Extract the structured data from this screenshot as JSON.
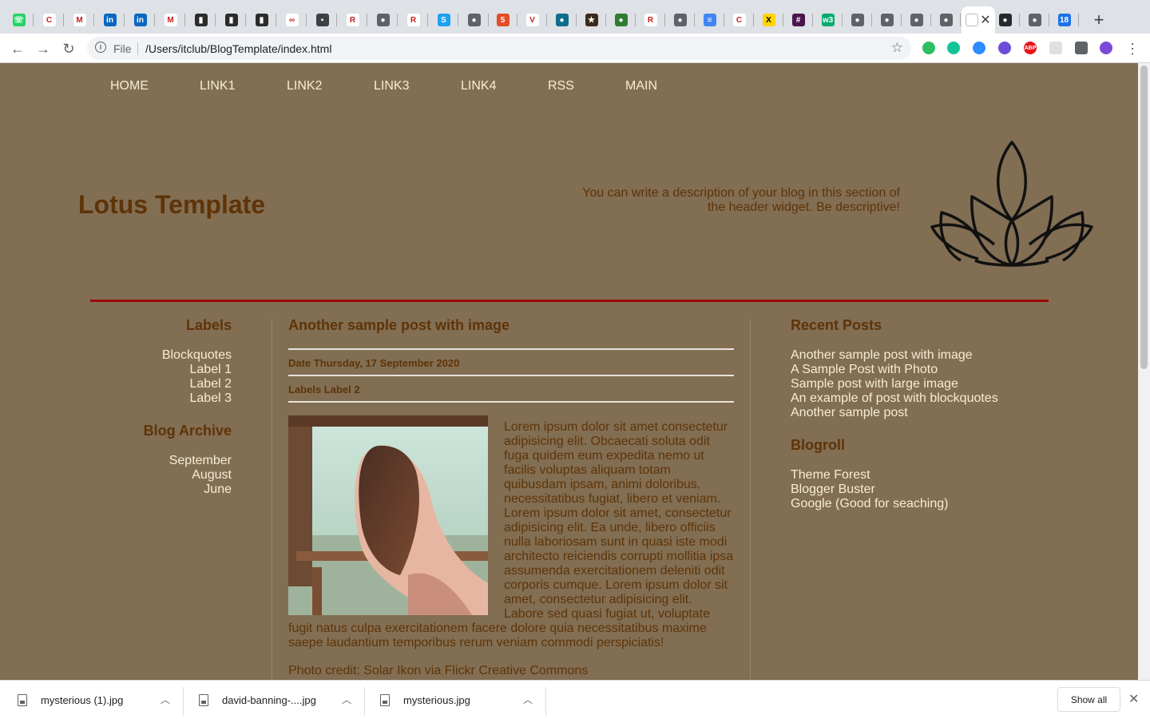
{
  "browser": {
    "tabs": [
      {
        "icon": "whatsapp-icon",
        "color": "#25d366",
        "glyph": "☏"
      },
      {
        "icon": "canon-icon",
        "color": "#ffffff",
        "glyph": "C"
      },
      {
        "icon": "gmail-icon",
        "color": "#ffffff",
        "glyph": "M"
      },
      {
        "icon": "linkedin-icon",
        "color": "#0a66c2",
        "glyph": "in"
      },
      {
        "icon": "linkedin-icon",
        "color": "#0a66c2",
        "glyph": "in"
      },
      {
        "icon": "gmail-icon",
        "color": "#ffffff",
        "glyph": "M"
      },
      {
        "icon": "book-icon",
        "color": "#2b2b2b",
        "glyph": "▮"
      },
      {
        "icon": "book-icon",
        "color": "#2b2b2b",
        "glyph": "▮"
      },
      {
        "icon": "book-icon",
        "color": "#2b2b2b",
        "glyph": "▮"
      },
      {
        "icon": "link-icon",
        "color": "#ffffff",
        "glyph": "∞"
      },
      {
        "icon": "contact-icon",
        "color": "#3c4043",
        "glyph": "▪"
      },
      {
        "icon": "r-icon",
        "color": "#ffffff",
        "glyph": "R"
      },
      {
        "icon": "globe-icon",
        "color": "#5f6368",
        "glyph": "●"
      },
      {
        "icon": "r-icon",
        "color": "#ffffff",
        "glyph": "R"
      },
      {
        "icon": "s-icon",
        "color": "#1da1f2",
        "glyph": "S"
      },
      {
        "icon": "globe-icon",
        "color": "#5f6368",
        "glyph": "●"
      },
      {
        "icon": "html5-icon",
        "color": "#e44d26",
        "glyph": "5"
      },
      {
        "icon": "v-icon",
        "color": "#ffffff",
        "glyph": "V"
      },
      {
        "icon": "drop-icon",
        "color": "#0d6e8c",
        "glyph": "●"
      },
      {
        "icon": "star-icon",
        "color": "#3b2a1a",
        "glyph": "★"
      },
      {
        "icon": "turtle-icon",
        "color": "#2e7d32",
        "glyph": "●"
      },
      {
        "icon": "r-icon",
        "color": "#ffffff",
        "glyph": "R"
      },
      {
        "icon": "globe-icon",
        "color": "#5f6368",
        "glyph": "●"
      },
      {
        "icon": "docs-icon",
        "color": "#4285f4",
        "glyph": "≡"
      },
      {
        "icon": "canon-icon",
        "color": "#ffffff",
        "glyph": "C"
      },
      {
        "icon": "x-icon",
        "color": "#ffd600",
        "glyph": "X"
      },
      {
        "icon": "slack-icon",
        "color": "#4a154b",
        "glyph": "#"
      },
      {
        "icon": "w3-icon",
        "color": "#04aa6d",
        "glyph": "w3"
      },
      {
        "icon": "globe-icon",
        "color": "#5f6368",
        "glyph": "●"
      },
      {
        "icon": "globe-icon",
        "color": "#5f6368",
        "glyph": "●"
      },
      {
        "icon": "globe-icon",
        "color": "#5f6368",
        "glyph": "●"
      },
      {
        "icon": "globe-icon",
        "color": "#5f6368",
        "glyph": "●"
      }
    ],
    "active_tab": {
      "icon": "page-icon"
    },
    "after_tabs": [
      {
        "icon": "github-icon",
        "color": "#24292e",
        "glyph": "●"
      },
      {
        "icon": "globe-icon",
        "color": "#5f6368",
        "glyph": "●"
      },
      {
        "icon": "calendar-icon",
        "color": "#1a73e8",
        "glyph": "18"
      }
    ],
    "url_scheme": "File",
    "url": "/Users/itclub/BlogTemplate/index.html",
    "extensions": [
      {
        "icon": "evernote-icon",
        "color": "#2dbe60"
      },
      {
        "icon": "grammarly-icon",
        "color": "#15c39a"
      },
      {
        "icon": "zoom-icon",
        "color": "#2d8cff"
      },
      {
        "icon": "check-icon",
        "color": "#6c4bd8"
      },
      {
        "icon": "adblock-icon",
        "color": "#e7141a",
        "label": "ABP"
      },
      {
        "icon": "frame-icon",
        "color": "#e0e0e0"
      },
      {
        "icon": "puzzle-icon",
        "color": "#5f6368"
      },
      {
        "icon": "profile-avatar",
        "color": "#7b4ad9"
      }
    ]
  },
  "blog": {
    "menu": [
      "HOME",
      "LINK1",
      "LINK2",
      "LINK3",
      "LINK4",
      "RSS",
      "MAIN"
    ],
    "title": "Lotus Template",
    "description": "You can write a description of your blog in this section of the header widget. Be descriptive!",
    "labels_heading": "Labels",
    "labels": [
      "Blockquotes",
      "Label 1",
      "Label 2",
      "Label 3"
    ],
    "archive_heading": "Blog Archive",
    "archive": [
      "September",
      "August",
      "June"
    ],
    "post": {
      "title": "Another sample post with image",
      "date": "Date Thursday, 17 September 2020",
      "labels": "Labels Label 2",
      "body": "Lorem ipsum dolor sit amet consectetur adipisicing elit. Obcaecati soluta odit fuga quidem eum expedita nemo ut facilis voluptas aliquam totam quibusdam ipsam, animi doloribus, necessitatibus fugiat, libero et veniam. Lorem ipsum dolor sit amet, consectetur adipisicing elit. Ea unde, libero officiis nulla laboriosam sunt in quasi iste modi architecto reiciendis corrupti mollitia ipsa assumenda exercitationem deleniti odit corporis cumque. Lorem ipsum dolor sit amet, consectetur adipisicing elit. Labore sed quasi fugiat ut, voluptate fugit natus culpa exercitationem facere dolore quia necessitatibus maxime saepe laudantium temporibus rerum veniam commodi perspiciatis!",
      "credit": "Photo credit: Solar Ikon via Flickr Creative Commons"
    },
    "recent_heading": "Recent Posts",
    "recent": [
      "Another sample post with image",
      "A Sample Post with Photo",
      "Sample post with large image",
      "An example of post with blockquotes",
      "Another sample post"
    ],
    "blogroll_heading": "Blogroll",
    "blogroll": [
      "Theme Forest",
      "Blogger Buster",
      "Google (Good for seaching)"
    ]
  },
  "downloads": {
    "items": [
      "mysterious (1).jpg",
      "david-banning-....jpg",
      "mysterious.jpg"
    ],
    "show_all": "Show all"
  },
  "colors": {
    "page_bg": "#826e53",
    "heading": "#5e3408",
    "link": "#f6edd4",
    "divider": "#9d0a0a"
  }
}
